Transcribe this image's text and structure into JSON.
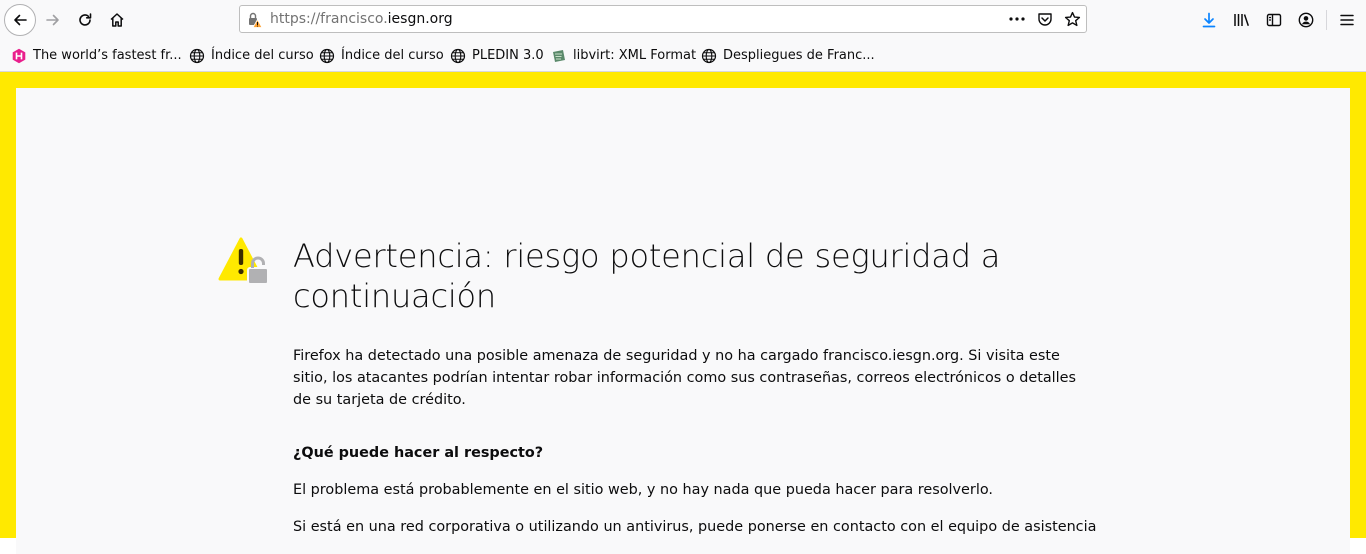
{
  "browser": {
    "url_prefix": "https://francisco.",
    "url_host": "iesgn.org",
    "colors": {
      "accent": "#0a84ff",
      "warning_background": "#ffe900"
    }
  },
  "bookmarks": [
    {
      "label": "The world’s fastest fr...",
      "icon": "hasura-logo-icon"
    },
    {
      "label": "Índice del curso",
      "icon": "globe-icon"
    },
    {
      "label": "Índice del curso",
      "icon": "globe-icon"
    },
    {
      "label": "PLEDIN 3.0",
      "icon": "globe-icon"
    },
    {
      "label": "libvirt: XML Format",
      "icon": "libvirt-logo-icon"
    },
    {
      "label": "Despliegues de Franc...",
      "icon": "globe-icon"
    }
  ],
  "error_page": {
    "title": "Advertencia: riesgo potencial de seguridad a continuación",
    "description": "Firefox ha detectado una posible amenaza de seguridad y no ha cargado francisco.iesgn.org. Si visita este sitio, los atacantes podrían intentar robar información como sus contraseñas, correos electrónicos o detalles de su tarjeta de crédito.",
    "what_heading": "¿Qué puede hacer al respecto?",
    "para1": "El problema está probablemente en el sitio web, y no hay nada que pueda hacer para resolverlo.",
    "para2": "Si está en una red corporativa o utilizando un antivirus, puede ponerse en contacto con el equipo de asistencia"
  }
}
